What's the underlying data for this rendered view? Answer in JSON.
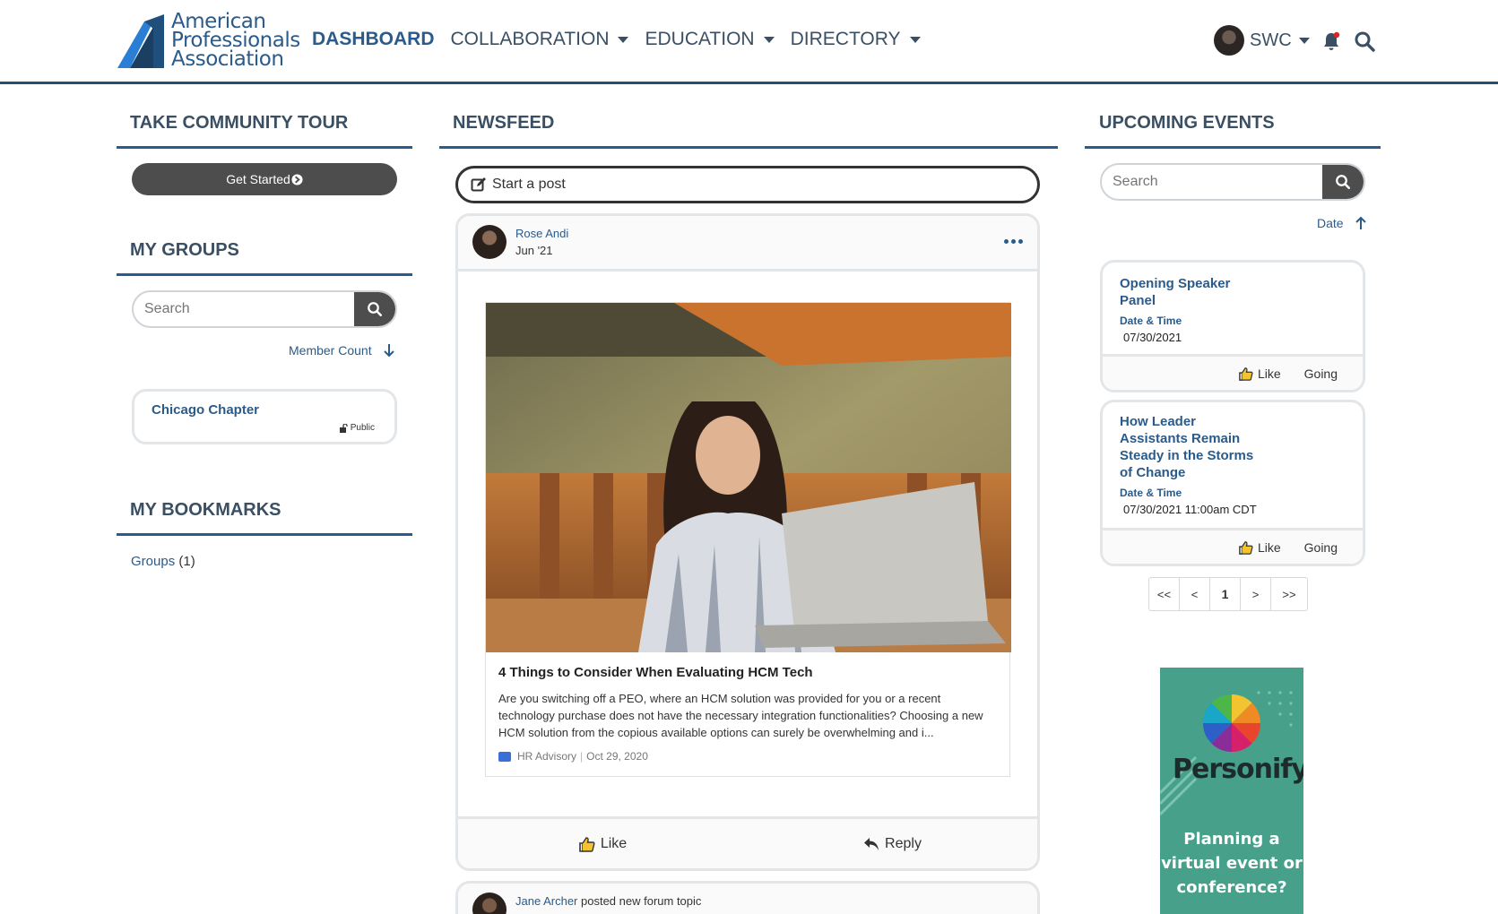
{
  "header": {
    "logo_lines": [
      "American",
      "Professionals",
      "Association"
    ],
    "nav": [
      {
        "label": "DASHBOARD",
        "active": true
      },
      {
        "label": "COLLABORATION",
        "dropdown": true
      },
      {
        "label": "EDUCATION",
        "dropdown": true
      },
      {
        "label": "DIRECTORY",
        "dropdown": true
      }
    ],
    "user_name": "SWC",
    "icons": [
      "user-avatar",
      "bell-icon",
      "search-icon"
    ],
    "accent": "#2a5b8a"
  },
  "left": {
    "tour_title": "TAKE COMMUNITY TOUR",
    "get_started": "Get Started",
    "groups_title": "MY GROUPS",
    "groups_search_placeholder": "Search",
    "groups_sort": "Member Count",
    "groups": [
      {
        "name": "Chicago Chapter",
        "visibility": "Public"
      }
    ],
    "bookmarks_title": "MY BOOKMARKS",
    "bookmarks_link": "Groups",
    "bookmarks_count": "(1)"
  },
  "newsfeed": {
    "title": "NEWSFEED",
    "start_post": "Start a post",
    "post": {
      "author": "Rose Andi",
      "date": "Jun '21",
      "article_title": "4 Things to Consider When Evaluating HCM Tech",
      "article_desc": "Are you switching off a PEO, where an HCM solution was provided for you or a recent technology purchase does not have the necessary integration functionalities? Choosing a new HCM solution from the copious available options can surely be overwhelming and i...",
      "source": "HR Advisory",
      "source_date": "Oct 29, 2020",
      "like": "Like",
      "reply": "Reply"
    },
    "post2": {
      "author": "Jane Archer",
      "action": "posted new forum topic"
    }
  },
  "events": {
    "title": "UPCOMING EVENTS",
    "search_placeholder": "Search",
    "sort": "Date",
    "items": [
      {
        "title_lines": [
          "Opening Speaker",
          "Panel"
        ],
        "label": "Date & Time",
        "date": "07/30/2021",
        "like": "Like",
        "going": "Going"
      },
      {
        "title_lines": [
          "How Leader",
          "Assistants Remain",
          "Steady in the Storms",
          "of Change"
        ],
        "label": "Date & Time",
        "date": "07/30/2021 11:00am CDT",
        "like": "Like",
        "going": "Going"
      }
    ],
    "pager": [
      "<<",
      "<",
      "1",
      ">",
      ">>"
    ]
  },
  "ad": {
    "brand": "Personify",
    "lines": [
      "Planning a",
      "virtual event or",
      "conference?"
    ],
    "bg": "#46a08a"
  }
}
